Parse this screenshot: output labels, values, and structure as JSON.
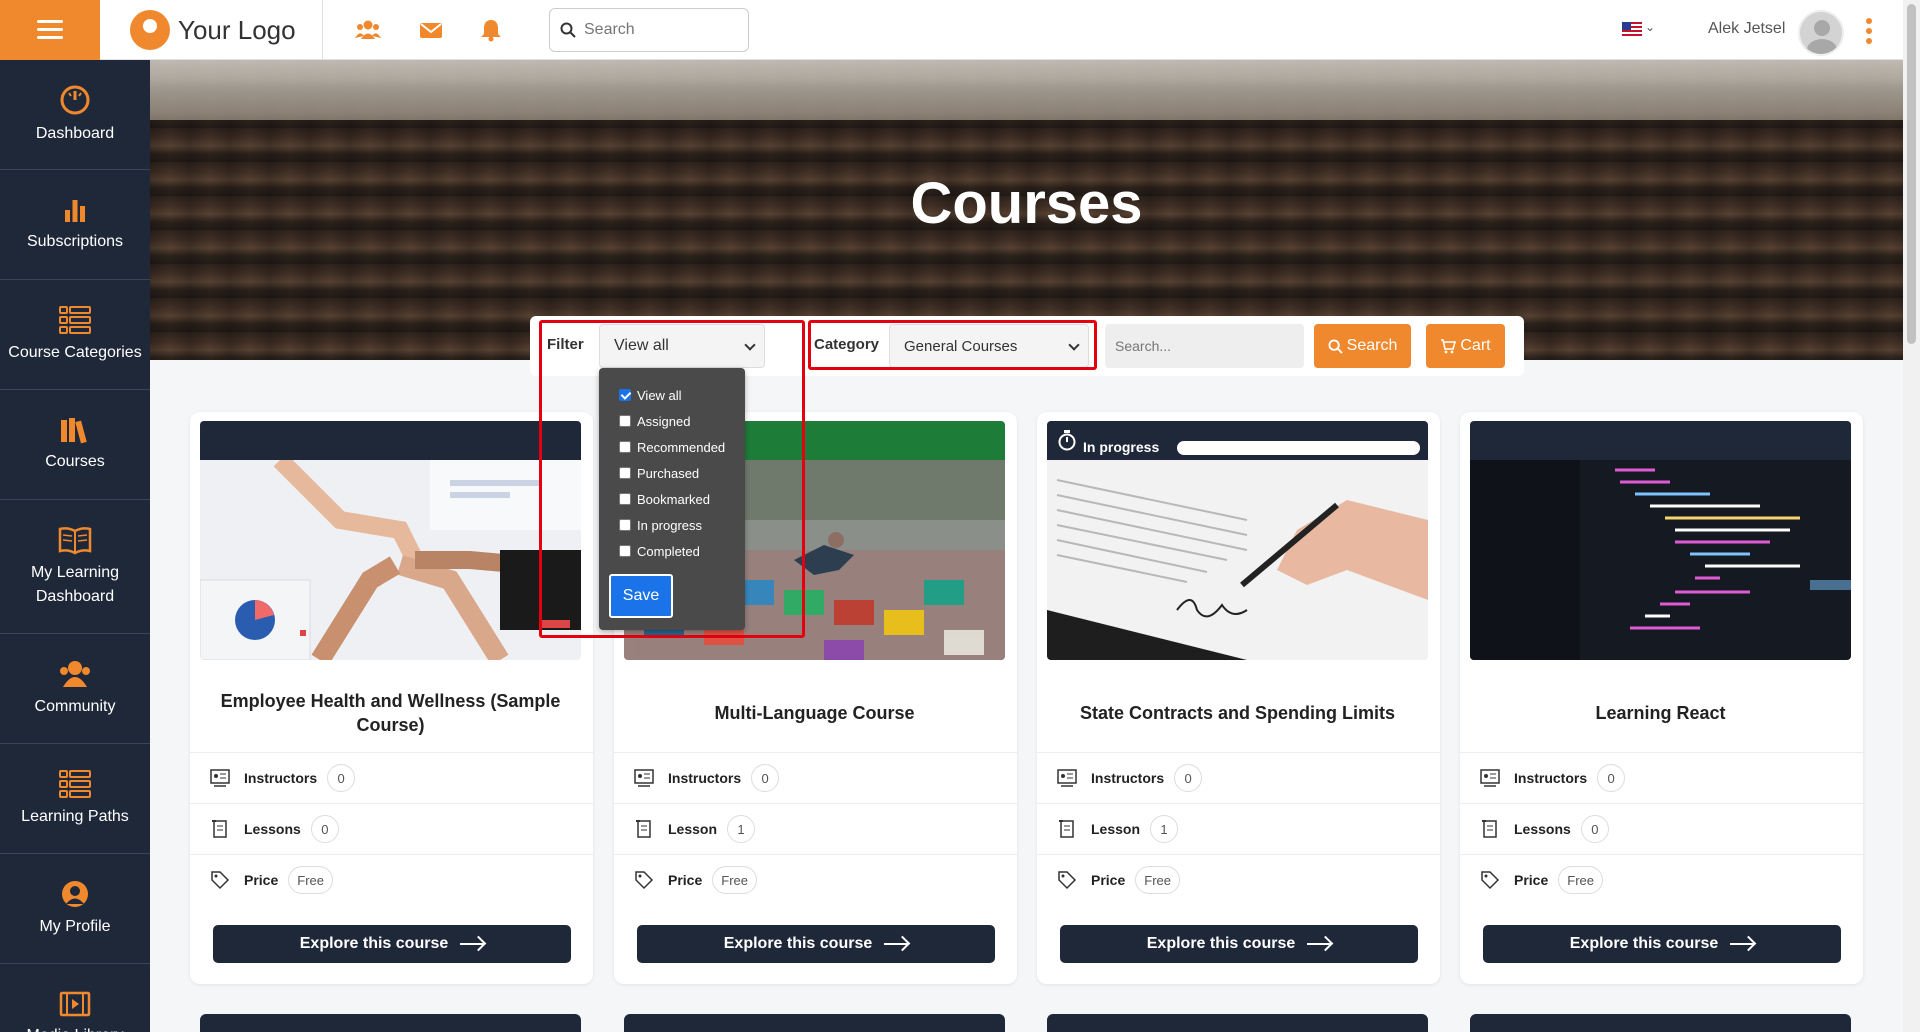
{
  "header": {
    "logo_text": "Your Logo",
    "search_placeholder": "Search",
    "user_name": "Alek Jetsel"
  },
  "sidebar": {
    "items": [
      {
        "label": "Dashboard",
        "icon": "dashboard-icon"
      },
      {
        "label": "Subscriptions",
        "icon": "bar-chart-icon"
      },
      {
        "label": "Course Categories",
        "icon": "list-icon"
      },
      {
        "label": "Courses",
        "icon": "books-icon"
      },
      {
        "label": "My Learning Dashboard",
        "icon": "open-book-icon"
      },
      {
        "label": "Community",
        "icon": "community-icon"
      },
      {
        "label": "Learning Paths",
        "icon": "list-icon"
      },
      {
        "label": "My Profile",
        "icon": "user-circle-icon"
      },
      {
        "label": "Media Library",
        "icon": "film-icon"
      }
    ]
  },
  "hero": {
    "title": "Courses"
  },
  "filterbar": {
    "filter_label": "Filter",
    "filter_value": "View all",
    "category_label": "Category",
    "category_value": "General Courses",
    "search_placeholder": "Search...",
    "search_button": "Search",
    "cart_button": "Cart"
  },
  "filter_dropdown": {
    "options": [
      {
        "label": "View all",
        "checked": true
      },
      {
        "label": "Assigned",
        "checked": false
      },
      {
        "label": "Recommended",
        "checked": false
      },
      {
        "label": "Purchased",
        "checked": false
      },
      {
        "label": "Bookmarked",
        "checked": false
      },
      {
        "label": "In progress",
        "checked": false
      },
      {
        "label": "Completed",
        "checked": false
      }
    ],
    "save_label": "Save"
  },
  "courses": [
    {
      "title": "Employee Health and Wellness (Sample Course)",
      "instructors_label": "Instructors",
      "instructors_count": "0",
      "lessons_label": "Lessons",
      "lessons_count": "0",
      "price_label": "Price",
      "price": "Free",
      "explore_label": "Explore this course"
    },
    {
      "title": "Multi-Language Course",
      "instructors_label": "Instructors",
      "instructors_count": "0",
      "lessons_label": "Lesson",
      "lessons_count": "1",
      "price_label": "Price",
      "price": "Free",
      "explore_label": "Explore this course"
    },
    {
      "title": "State Contracts and Spending Limits",
      "status": "In progress",
      "progress_fraction": 0.0,
      "instructors_label": "Instructors",
      "instructors_count": "0",
      "lessons_label": "Lesson",
      "lessons_count": "1",
      "price_label": "Price",
      "price": "Free",
      "explore_label": "Explore this course"
    },
    {
      "title": "Learning React",
      "instructors_label": "Instructors",
      "instructors_count": "0",
      "lessons_label": "Lessons",
      "lessons_count": "0",
      "price_label": "Price",
      "price": "Free",
      "explore_label": "Explore this course"
    }
  ],
  "colors": {
    "accent": "#f0882e",
    "sidebar": "#1f2839",
    "highlight": "#e3000f",
    "primary_blue": "#1a73e8",
    "green_header": "#1d7d38"
  }
}
